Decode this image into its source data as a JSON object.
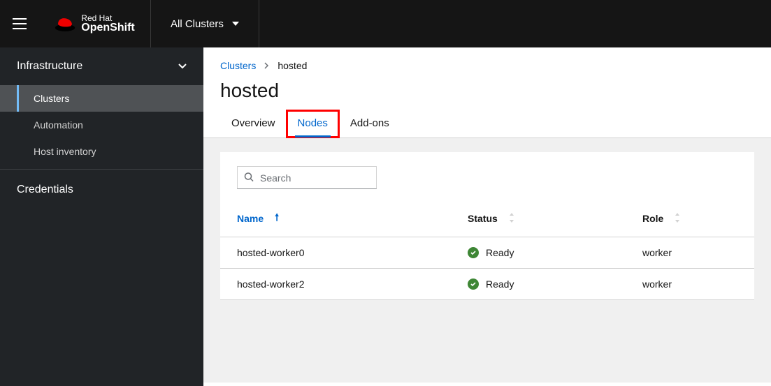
{
  "header": {
    "brand_top": "Red Hat",
    "brand_bottom": "OpenShift",
    "switcher_label": "All Clusters"
  },
  "sidebar": {
    "section": "Infrastructure",
    "items": [
      {
        "label": "Clusters",
        "active": true
      },
      {
        "label": "Automation",
        "active": false
      },
      {
        "label": "Host inventory",
        "active": false
      }
    ],
    "credentials": "Credentials"
  },
  "breadcrumbs": {
    "link": "Clusters",
    "current": "hosted"
  },
  "page_title": "hosted",
  "tabs": [
    {
      "label": "Overview",
      "active": false
    },
    {
      "label": "Nodes",
      "active": true
    },
    {
      "label": "Add-ons",
      "active": false
    }
  ],
  "search": {
    "placeholder": "Search"
  },
  "table": {
    "columns": {
      "name": "Name",
      "status": "Status",
      "role": "Role"
    },
    "rows": [
      {
        "name": "hosted-worker0",
        "status": "Ready",
        "role": "worker"
      },
      {
        "name": "hosted-worker2",
        "status": "Ready",
        "role": "worker"
      }
    ]
  }
}
